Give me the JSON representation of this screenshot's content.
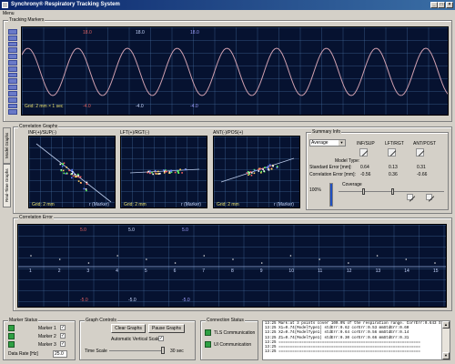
{
  "window": {
    "title": "Synchrony® Respiratory Tracking System",
    "minimize": "_",
    "maximize": "□",
    "close": "×"
  },
  "menu": {
    "label": "Menu"
  },
  "tracking": {
    "section_label": "Tracking Markers",
    "top_labels": [
      "18.0",
      "18.0",
      "18.0"
    ],
    "bottom_labels": [
      "-4.0",
      "-4.0",
      "-4.0"
    ],
    "grid_label": "Grid: 2 mm × 1 sec",
    "colors": {
      "trace": "#d0a0b0",
      "background": "#061230"
    }
  },
  "side_tabs": [
    "Model Graphs",
    "Real-Time Graphs"
  ],
  "correlation": {
    "section_label": "Correlation Graphs",
    "graphs": [
      {
        "title": "INF(+)/SUP(-)",
        "grid": "Grid: 2 mm",
        "axis": "r (Marker)"
      },
      {
        "title": "LFT(+)/RGT(-)",
        "grid": "Grid: 2 mm",
        "axis": "r (Marker)"
      },
      {
        "title": "ANT(-)/POS(+)",
        "grid": "Grid: 2 mm",
        "axis": "r (Marker)"
      }
    ]
  },
  "summary": {
    "section_label": "Summary Info",
    "dropdown_value": "Average",
    "headers": [
      "INF/SUP",
      "LFT/RGT",
      "ANT/POST"
    ],
    "rows": [
      {
        "label": "Model Type:",
        "values": [
          "",
          "",
          ""
        ]
      },
      {
        "label": "Standard Error [mm]:",
        "values": [
          "0.64",
          "0.13",
          "0.31"
        ]
      },
      {
        "label": "Correlation Error [mm]:",
        "values": [
          "-0.56",
          "0.36",
          "-0.66"
        ]
      }
    ],
    "coverage_label": "Coverage",
    "coverage_value": "100%",
    "coverage_fraction": 1.0
  },
  "corr_error": {
    "section_label": "Correlation Error",
    "top_labels": [
      "5.0",
      "5.0",
      "5.0"
    ],
    "bottom_labels": [
      "-5.0",
      "-5.0",
      "-5.0"
    ],
    "ticks": [
      "1",
      "2",
      "3",
      "4",
      "5",
      "6",
      "7",
      "8",
      "9",
      "10",
      "11",
      "12",
      "13",
      "14",
      "15"
    ]
  },
  "marker_status": {
    "section_label": "Marker Status",
    "markers": [
      {
        "label": "Marker 1",
        "checked": "✓"
      },
      {
        "label": "Marker 2",
        "checked": "✓"
      },
      {
        "label": "Marker 3",
        "checked": "✓"
      }
    ],
    "data_rate_label": "Data Rate [Hz]",
    "data_rate_value": "25.0",
    "led_color": "#2ea043"
  },
  "graph_controls": {
    "section_label": "Graph Controls",
    "clear_button": "Clear Graphs",
    "pause_button": "Pause Graphs",
    "auto_scale_label": "Automatic Vertical Scale",
    "auto_scale_checked": "✓",
    "time_scale_label": "Time Scale",
    "time_scale_value": "30 sec"
  },
  "connection": {
    "section_label": "Connection Status",
    "items": [
      "TLS Communication",
      "UI Communication"
    ]
  },
  "log": {
    "lines": [
      "13:25  Mark:at 3 points cover 100.0% of the respiration range. CorrErr:0.643 StdErr:0.003",
      "13:25  X1=0.74(ModelType1) stdErr:0.62 corErr:0.53 mmStdErr:0.60",
      "13:25  X2=0.74(ModelType1) stdErr:0.64 corErr:0.56 mmStdErr:0.14",
      "13:25  Z1=0.74(ModelType1) stdErr:0.30 corErr:0.66 mmStdErr:0.31",
      "13:25  ==============================================================",
      "13:25  ==============================================================",
      "13:25  =============================================================="
    ]
  }
}
